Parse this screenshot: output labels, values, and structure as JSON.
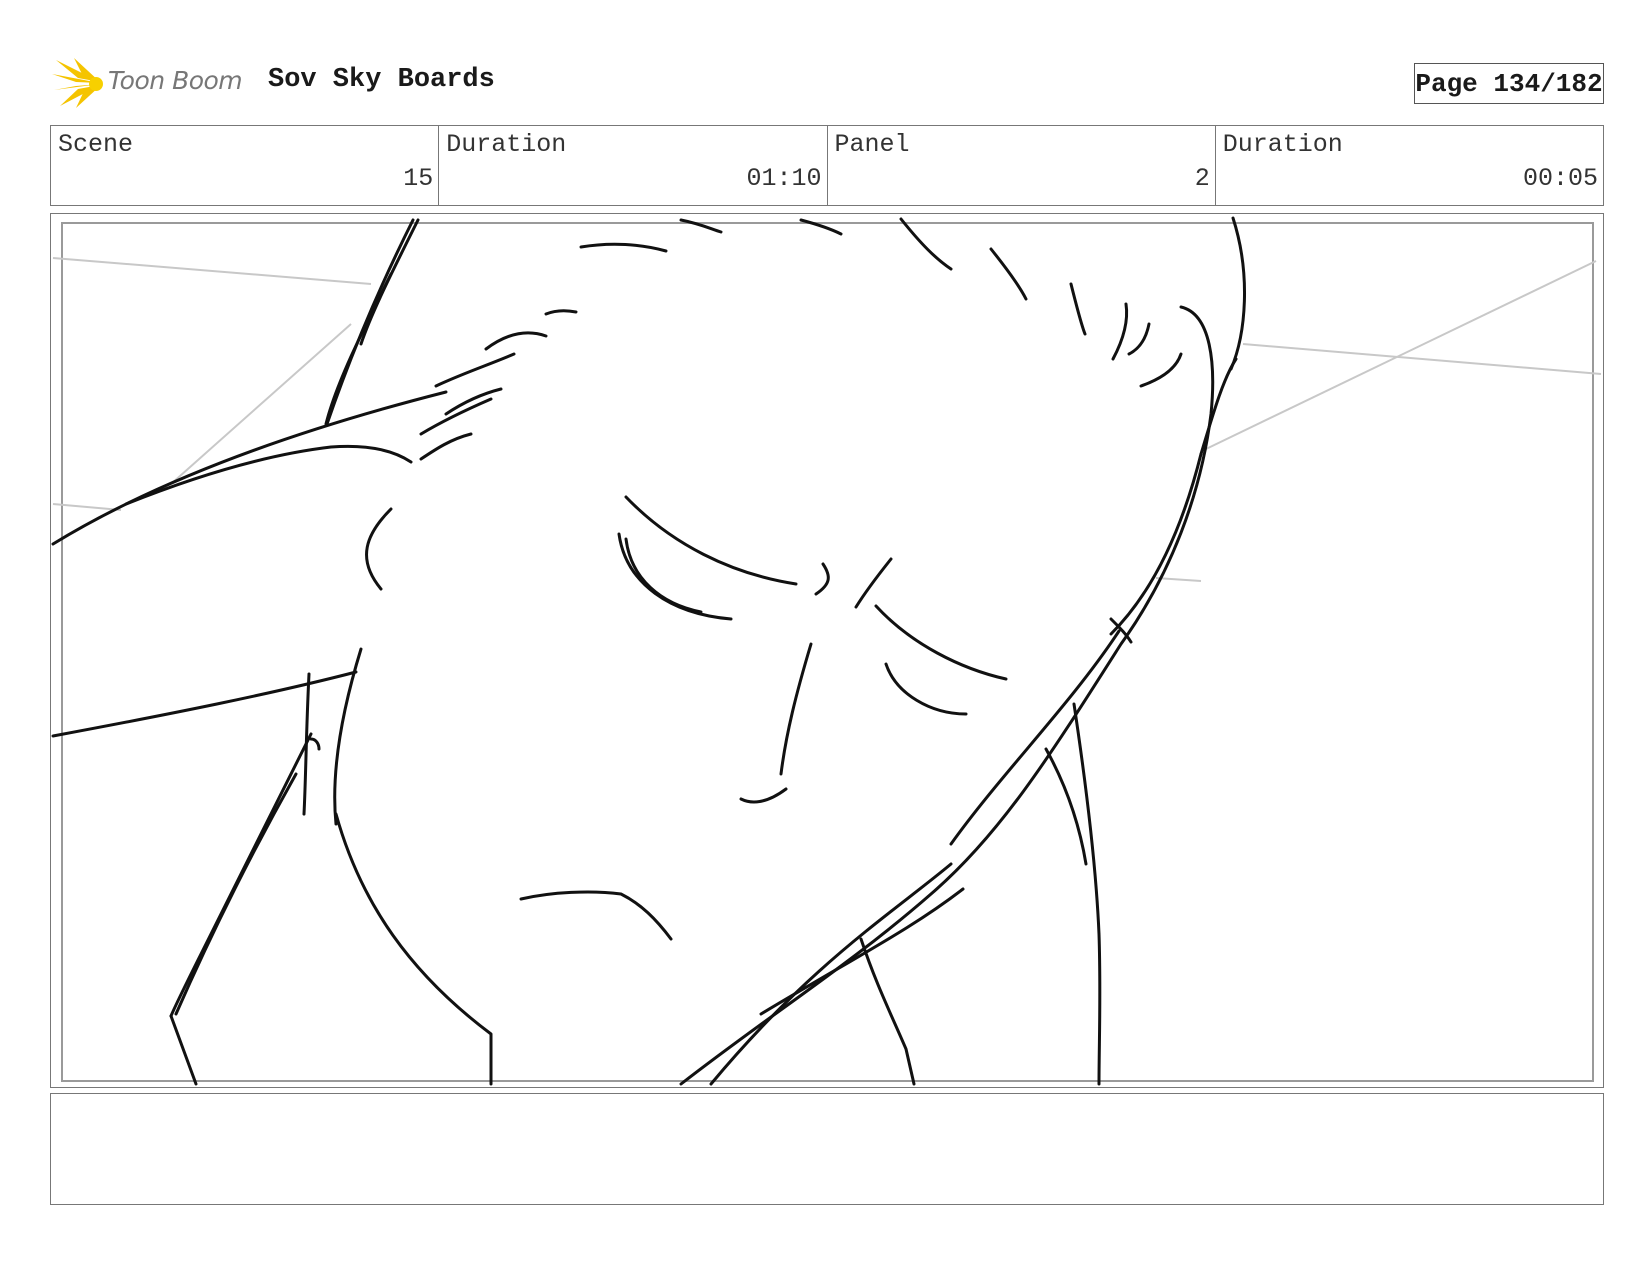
{
  "header": {
    "logo_text": "Toon Boom",
    "project_title": "Sov Sky Boards",
    "page_label": "Page 134/182"
  },
  "info": {
    "scene_label": "Scene",
    "scene_value": "15",
    "scene_duration_label": "Duration",
    "scene_duration_value": "01:10",
    "panel_label": "Panel",
    "panel_value": "2",
    "panel_duration_label": "Duration",
    "panel_duration_value": "00:05"
  },
  "notes": {
    "text": ""
  }
}
